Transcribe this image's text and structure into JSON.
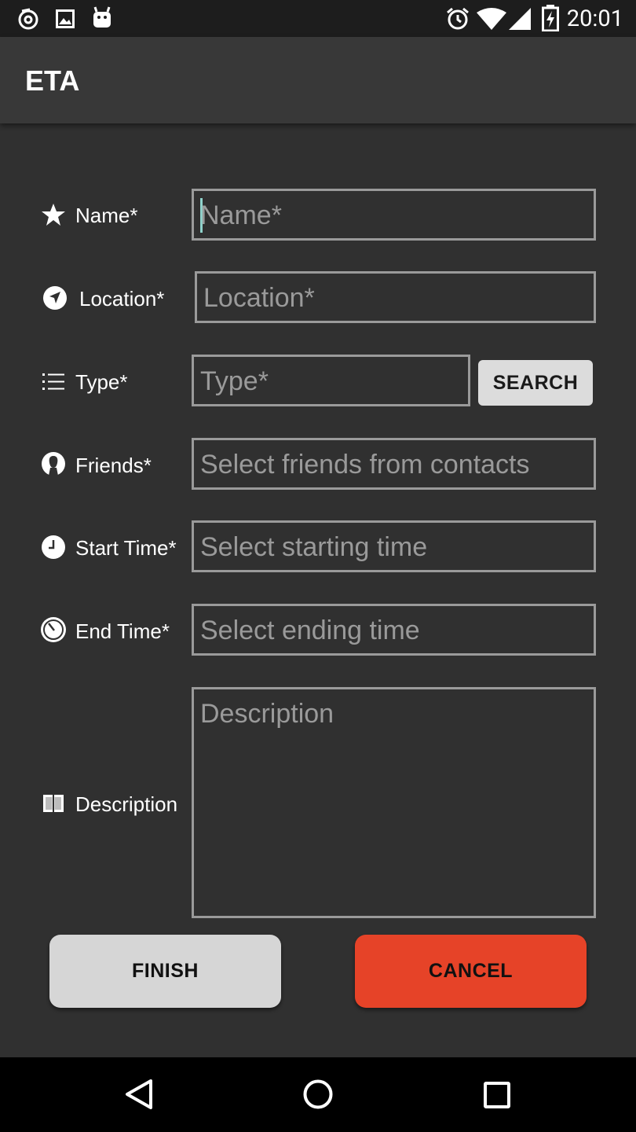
{
  "status_bar": {
    "time": "20:01",
    "left_icons": [
      "notification-swirl-icon",
      "image-icon",
      "android-icon"
    ],
    "right_icons": [
      "alarm-icon",
      "wifi-icon",
      "signal-icon",
      "battery-charging-icon"
    ]
  },
  "app_bar": {
    "title": "ETA"
  },
  "form": {
    "name": {
      "label": "Name*",
      "placeholder": "Name*",
      "icon": "star-icon"
    },
    "location": {
      "label": "Location*",
      "placeholder": "Location*",
      "icon": "navigation-icon"
    },
    "type": {
      "label": "Type*",
      "placeholder": "Type*",
      "icon": "list-icon",
      "search_label": "SEARCH"
    },
    "friends": {
      "label": "Friends*",
      "placeholder": "Select friends from contacts",
      "icon": "person-icon"
    },
    "start_time": {
      "label": "Start Time*",
      "placeholder": "Select starting time",
      "icon": "clock-icon"
    },
    "end_time": {
      "label": "End Time*",
      "placeholder": "Select ending time",
      "icon": "timer-icon"
    },
    "description": {
      "label": "Description",
      "placeholder": "Description",
      "icon": "book-icon"
    }
  },
  "actions": {
    "finish_label": "FINISH",
    "cancel_label": "CANCEL"
  },
  "colors": {
    "background": "#303030",
    "app_bar": "#383838",
    "field_border": "#9a9a9a",
    "placeholder": "#9a9a9a",
    "cursor": "#8fd3cc",
    "cancel_button": "#e64328",
    "finish_button": "#d6d6d6"
  },
  "nav_bar": {
    "icons": [
      "back-icon",
      "home-icon",
      "recents-icon"
    ]
  }
}
